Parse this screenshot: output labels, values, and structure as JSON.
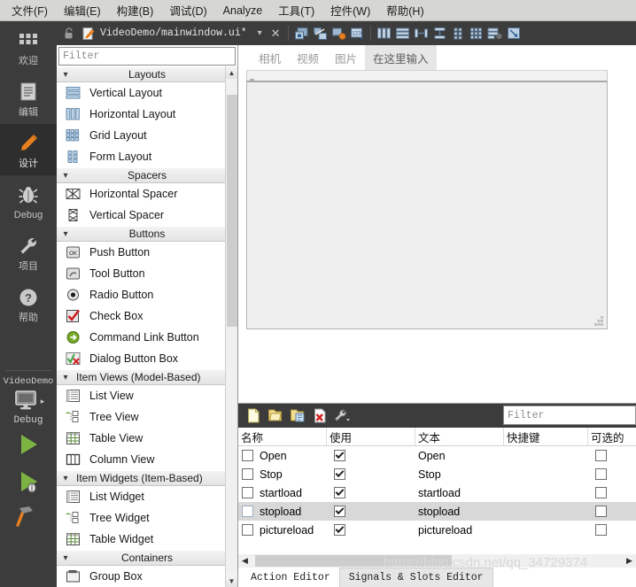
{
  "menubar": {
    "items": [
      {
        "label": "文件(F)",
        "name": "menu-file"
      },
      {
        "label": "编辑(E)",
        "name": "menu-edit"
      },
      {
        "label": "构建(B)",
        "name": "menu-build"
      },
      {
        "label": "调试(D)",
        "name": "menu-debug"
      },
      {
        "label": "Analyze",
        "name": "menu-analyze"
      },
      {
        "label": "工具(T)",
        "name": "menu-tools"
      },
      {
        "label": "控件(W)",
        "name": "menu-window"
      },
      {
        "label": "帮助(H)",
        "name": "menu-help"
      }
    ]
  },
  "modebar": {
    "items": [
      {
        "label": "欢迎",
        "icon": "grid-icon",
        "active": false
      },
      {
        "label": "编辑",
        "icon": "document-icon",
        "active": false
      },
      {
        "label": "设计",
        "icon": "pencil-icon",
        "active": true
      },
      {
        "label": "Debug",
        "icon": "bug-icon",
        "active": false
      },
      {
        "label": "项目",
        "icon": "wrench-icon",
        "active": false
      },
      {
        "label": "帮助",
        "icon": "question-icon",
        "active": false
      }
    ],
    "project": {
      "name": "VideoDemo",
      "kit": "Debug",
      "target_icon": "monitor-icon",
      "run_icon": "run-triangle-icon",
      "debug_icon": "debug-run-icon",
      "build_icon": "hammer-icon"
    }
  },
  "filebar": {
    "lock_icon": "unlock-icon",
    "file_icon": "ui-file-icon",
    "filename": "VideoDemo/mainwindow.ui*",
    "dropdown_icon": "chevron-down-icon",
    "close_icon": "close-icon",
    "tools": [
      {
        "name": "edit-widgets-tool",
        "title": "Edit Widgets"
      },
      {
        "name": "edit-signals-slots-tool",
        "title": "Edit Signals/Slots"
      },
      {
        "name": "edit-buddies-tool",
        "title": "Edit Buddies"
      },
      {
        "name": "edit-tab-order-tool",
        "title": "Edit Tab Order"
      },
      {
        "name": "layout-horizontally-tool",
        "title": "Lay Out Horizontally"
      },
      {
        "name": "layout-vertically-tool",
        "title": "Lay Out Vertically"
      },
      {
        "name": "layout-splitter-horizontal-tool",
        "title": "Lay Out Horizontally in Splitter"
      },
      {
        "name": "layout-splitter-vertical-tool",
        "title": "Lay Out Vertically in Splitter"
      },
      {
        "name": "layout-form-tool",
        "title": "Lay Out in a Form Layout"
      },
      {
        "name": "layout-grid-tool",
        "title": "Lay Out in a Grid"
      },
      {
        "name": "break-layout-tool",
        "title": "Break Layout"
      },
      {
        "name": "adjust-size-tool",
        "title": "Adjust Size"
      }
    ]
  },
  "widgetbox": {
    "filter_placeholder": "Filter",
    "groups": [
      {
        "title": "Layouts",
        "expanded": true,
        "items": [
          {
            "label": "Vertical Layout",
            "icon": "vertical-layout-icon"
          },
          {
            "label": "Horizontal Layout",
            "icon": "horizontal-layout-icon"
          },
          {
            "label": "Grid Layout",
            "icon": "grid-layout-icon"
          },
          {
            "label": "Form Layout",
            "icon": "form-layout-icon"
          }
        ]
      },
      {
        "title": "Spacers",
        "expanded": true,
        "items": [
          {
            "label": "Horizontal Spacer",
            "icon": "horizontal-spacer-icon"
          },
          {
            "label": "Vertical Spacer",
            "icon": "vertical-spacer-icon"
          }
        ]
      },
      {
        "title": "Buttons",
        "expanded": true,
        "items": [
          {
            "label": "Push Button",
            "icon": "push-button-icon"
          },
          {
            "label": "Tool Button",
            "icon": "tool-button-icon"
          },
          {
            "label": "Radio Button",
            "icon": "radio-button-icon"
          },
          {
            "label": "Check Box",
            "icon": "check-box-icon"
          },
          {
            "label": "Command Link Button",
            "icon": "command-link-icon"
          },
          {
            "label": "Dialog Button Box",
            "icon": "dialog-button-box-icon"
          }
        ]
      },
      {
        "title": "Item Views (Model-Based)",
        "expanded": true,
        "items": [
          {
            "label": "List View",
            "icon": "list-view-icon"
          },
          {
            "label": "Tree View",
            "icon": "tree-view-icon"
          },
          {
            "label": "Table View",
            "icon": "table-view-icon"
          },
          {
            "label": "Column View",
            "icon": "column-view-icon"
          }
        ]
      },
      {
        "title": "Item Widgets (Item-Based)",
        "expanded": true,
        "items": [
          {
            "label": "List Widget",
            "icon": "list-widget-icon"
          },
          {
            "label": "Tree Widget",
            "icon": "tree-widget-icon"
          },
          {
            "label": "Table Widget",
            "icon": "table-widget-icon"
          }
        ]
      },
      {
        "title": "Containers",
        "expanded": true,
        "items": [
          {
            "label": "Group Box",
            "icon": "group-box-icon"
          }
        ]
      }
    ]
  },
  "canvas": {
    "tabs": [
      {
        "label": "相机",
        "active": false
      },
      {
        "label": "视频",
        "active": false
      },
      {
        "label": "图片",
        "active": false
      },
      {
        "label": "在这里输入",
        "active": true
      }
    ]
  },
  "action_editor": {
    "toolbar": [
      {
        "name": "new-action-button",
        "icon": "new-file-icon"
      },
      {
        "name": "copy-action-button",
        "icon": "copy-icon"
      },
      {
        "name": "paste-action-button",
        "icon": "paste-icon"
      },
      {
        "name": "delete-action-button",
        "icon": "delete-icon"
      },
      {
        "name": "configure-action-button",
        "icon": "wrench-icon"
      }
    ],
    "filter_placeholder": "Filter",
    "columns": [
      "名称",
      "使用",
      "文本",
      "快捷键",
      "可选的"
    ],
    "rows": [
      {
        "name": "Open",
        "used": true,
        "text": "Open",
        "shortcut": "",
        "checkable": false,
        "selected": false
      },
      {
        "name": "Stop",
        "used": true,
        "text": "Stop",
        "shortcut": "",
        "checkable": false,
        "selected": false
      },
      {
        "name": "startload",
        "used": true,
        "text": "startload",
        "shortcut": "",
        "checkable": false,
        "selected": false
      },
      {
        "name": "stopload",
        "used": true,
        "text": "stopload",
        "shortcut": "",
        "checkable": false,
        "selected": true
      },
      {
        "name": "pictureload",
        "used": true,
        "text": "pictureload",
        "shortcut": "",
        "checkable": false,
        "selected": false
      }
    ],
    "bottom_tabs": [
      {
        "label": "Action Editor",
        "active": true
      },
      {
        "label": "Signals & Slots Editor",
        "active": false
      }
    ]
  },
  "watermark": "https://blog.csdn.net/qq_34729374",
  "colors": {
    "menubar_bg": "#d6d6d2",
    "dark_panel": "#3c3c3c",
    "modebar_bg": "#3c3c3c",
    "mode_active_bg": "#2e2e2e",
    "accent_orange": "#e8801f",
    "run_green": "#7cb342",
    "selection_gray": "#d8d8d8"
  }
}
